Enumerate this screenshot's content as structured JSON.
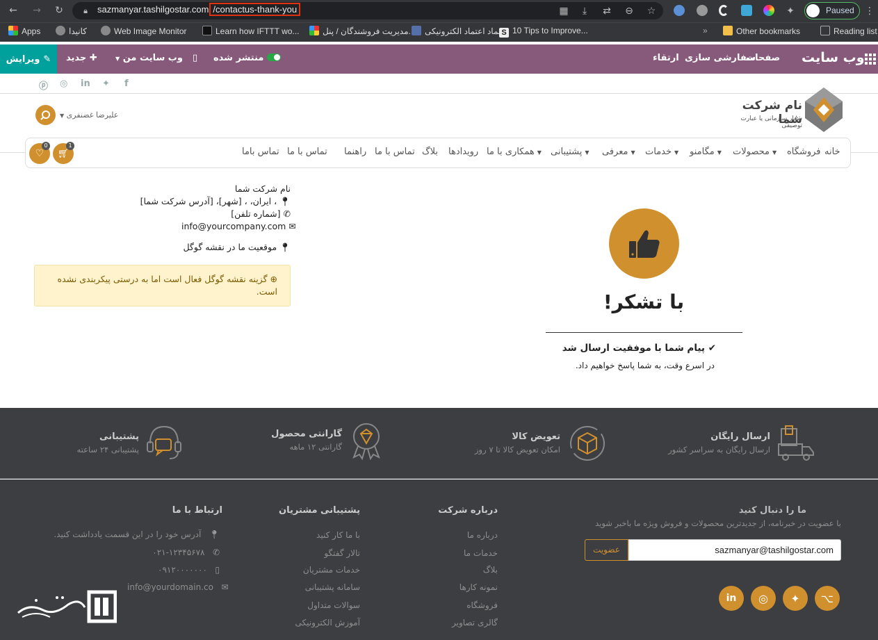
{
  "browser": {
    "url_host": "sazmanyar.tashilgostar.com",
    "url_path": "/contactus-thank-you",
    "profile_label": "Paused",
    "bookmarks": [
      "Apps",
      "کانیدا",
      "Web Image Monitor",
      "Learn how IFTTT wo...",
      "مدیریت فروشندگان / پنل...",
      "نماد اعتماد الکترونیکی",
      "10 Tips to Improve...",
      "Other bookmarks",
      "Reading list"
    ]
  },
  "odoo_bar": {
    "title": "وب سایت",
    "pages": "صفحات",
    "customize": "سفارشی سازی",
    "upgrade": "ارتقاء",
    "published": "منتشر شده",
    "my_site": "وب سایت من",
    "new": "جدید",
    "edit": "ویرایش"
  },
  "header": {
    "company_name": "نام شرکت شما",
    "tagline": "شعار سازمانی یا عبارت توصیفی",
    "user_name": "علیرضا غضنفری",
    "cart_count": "1",
    "wishlist_count": "0"
  },
  "nav": {
    "items": [
      "خانه",
      "فروشگاه",
      "محصولات",
      "مگامنو",
      "خدمات",
      "معرفی",
      "پشتیبانی",
      "همکاری با ما",
      "رویدادها",
      "بلاگ",
      "تماس با ما",
      "راهنما",
      "تماس با ما",
      "تماس باما"
    ]
  },
  "contact": {
    "company": "نام شرکت شما",
    "address": "، ایران، ، [شهر]، [آدرس شرکت شما]",
    "phone": "[شماره تلفن]",
    "email": "info@yourcompany.com",
    "map": "موقعیت ما در نقشه گوگل",
    "alert_line1": "گزینه نقشه گوگل فعال است اما به درستی پیکربندی نشده",
    "alert_line2": "است."
  },
  "thanks": {
    "title": "با تشکر!",
    "message": "پیام شما با موفقیت ارسال شد",
    "sub": "در اسرع وقت، به شما پاسخ خواهیم داد."
  },
  "features": [
    {
      "title": "ارسال رایگان",
      "sub": "ارسال رایگان به سراسر کشور"
    },
    {
      "title": "تعویض کالا",
      "sub": "امکان تعویض کالا تا ۷ روز"
    },
    {
      "title": "گارانتی محصول",
      "sub": "گارانتی ۱۲ ماهه"
    },
    {
      "title": "پشتیبانی",
      "sub": "پشتیبانی ۲۴ ساعته"
    }
  ],
  "footer": {
    "newsletter_title": "ما را دنبال کنید",
    "newsletter_sub": "با عضویت در خبرنامه، از جدیدترین محصولات و فروش ویژه ما باخبر شوید",
    "email_value": "sazmanyar@tashilgostar.com",
    "subscribe": "عضویت",
    "about_title": "درباره شرکت",
    "about_links": [
      "درباره ما",
      "خدمات ما",
      "بلاگ",
      "نمونه کارها",
      "فروشگاه",
      "گالری تصاویر"
    ],
    "support_title": "پشتیبانی مشتریان",
    "support_links": [
      "با ما کار کنید",
      "تالار گفتگو",
      "خدمات مشتریان",
      "سامانه پشتیبانی",
      "سوالات متداول",
      "آموزش الکترونیکی"
    ],
    "contact_title": "ارتباط با ما",
    "contact_address": "آدرس خود را در این قسمت یادداشت کنید.",
    "contact_phone": "۰۲۱-۱۲۳۴۵۶۷۸",
    "contact_mobile": "۰۹۱۲۰۰۰۰۰۰۰",
    "contact_email": "info@yourdomain.co"
  },
  "colors": {
    "accent": "#d1902e",
    "odoo_purple": "#875a7b",
    "teal": "#00a09d",
    "footer_bg": "#3d3e42"
  }
}
